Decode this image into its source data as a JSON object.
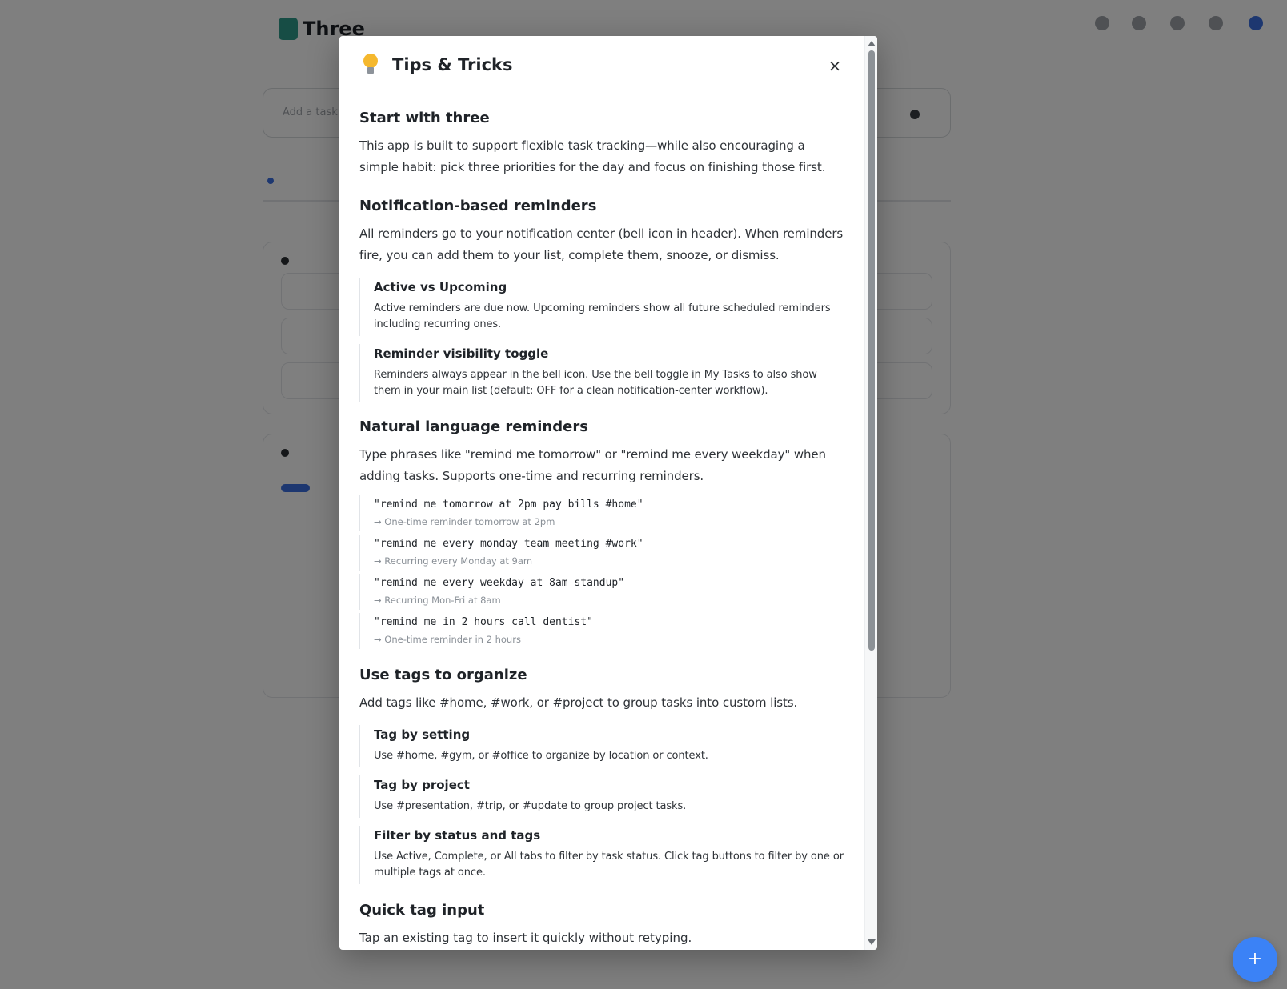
{
  "app": {
    "logo_text": "Three",
    "quick_input_placeholder": "Add a task"
  },
  "fab": {
    "label": "+"
  },
  "modal": {
    "title": "Tips & Tricks",
    "close_label": "×",
    "sections": [
      {
        "title": "Start with three",
        "text": "This app is built to support flexible task tracking—while also encouraging a simple habit: pick three priorities for the day and focus on finishing those first."
      },
      {
        "title": "Notification-based reminders",
        "text": "All reminders go to your notification center (bell icon in header). When reminders fire, you can add them to your list, complete them, snooze, or dismiss.",
        "items": [
          {
            "title": "Active vs Upcoming",
            "text": "Active reminders are due now. Upcoming reminders show all future scheduled reminders including recurring ones."
          },
          {
            "title": "Reminder visibility toggle",
            "text": "Reminders always appear in the bell icon. Use the bell toggle in My Tasks to also show them in your main list (default: OFF for a clean notification-center workflow)."
          }
        ]
      },
      {
        "title": "Natural language reminders",
        "text": "Type phrases like \"remind me tomorrow\" or \"remind me every weekday\" when adding tasks. Supports one-time and recurring reminders.",
        "examples": [
          {
            "code": "\"remind me tomorrow at 2pm pay bills #home\"",
            "note": "→ One-time reminder tomorrow at 2pm"
          },
          {
            "code": "\"remind me every monday team meeting #work\"",
            "note": "→ Recurring every Monday at 9am"
          },
          {
            "code": "\"remind me every weekday at 8am standup\"",
            "note": "→ Recurring Mon-Fri at 8am"
          },
          {
            "code": "\"remind me in 2 hours call dentist\"",
            "note": "→ One-time reminder in 2 hours"
          }
        ]
      },
      {
        "title": "Use tags to organize",
        "text": "Add tags like #home, #work, or #project to group tasks into custom lists.",
        "items": [
          {
            "title": "Tag by setting",
            "text": "Use #home, #gym, or #office to organize by location or context."
          },
          {
            "title": "Tag by project",
            "text": "Use #presentation, #trip, or #update to group project tasks."
          },
          {
            "title": "Filter by status and tags",
            "text": "Use Active, Complete, or All tabs to filter by task status. Click tag buttons to filter by one or multiple tags at once."
          }
        ]
      },
      {
        "title": "Quick tag input",
        "text": "Tap an existing tag to insert it quickly without retyping."
      }
    ]
  }
}
